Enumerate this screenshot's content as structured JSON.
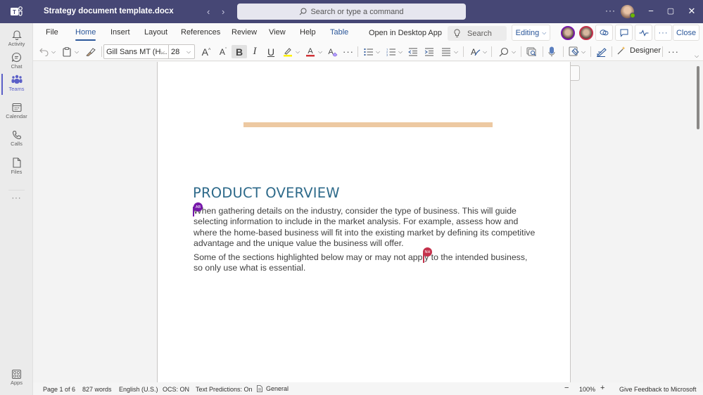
{
  "titlebar": {
    "app_icon": "teams-logo-icon",
    "title": "Strategy document template.docx",
    "back": "‹",
    "forward": "›",
    "search_placeholder": "Search or type a command",
    "more": "···",
    "minimize": "−",
    "maximize": "▢",
    "close": "✕"
  },
  "rail": {
    "items": [
      {
        "label": "Activity",
        "icon": "bell-icon"
      },
      {
        "label": "Chat",
        "icon": "chat-icon"
      },
      {
        "label": "Teams",
        "icon": "teams-icon",
        "active": true
      },
      {
        "label": "Calendar",
        "icon": "calendar-icon"
      },
      {
        "label": "Calls",
        "icon": "phone-icon"
      },
      {
        "label": "Files",
        "icon": "file-icon"
      }
    ],
    "more": "···",
    "apps_label": "Apps"
  },
  "ribbon": {
    "tabs": [
      "File",
      "Home",
      "Insert",
      "Layout",
      "References",
      "Review",
      "View",
      "Help",
      "Table"
    ],
    "active_tab": "Home",
    "open_desktop": "Open in Desktop App",
    "search_placeholder": "Search",
    "editing_label": "Editing",
    "close_label": "Close",
    "coauthor_colors": [
      "#7719aa",
      "#c4314b"
    ]
  },
  "toolbar": {
    "font_name": "Gill Sans MT (H...",
    "font_size": "28",
    "bold": "B",
    "italic": "I",
    "underline": "U",
    "more": "···",
    "designer_label": "Designer",
    "highlight_color": "#fff100",
    "font_color": "#d13438"
  },
  "document": {
    "heading": "PRODUCT OVERVIEW",
    "paragraphs": [
      "When gathering details on the industry, consider the type of business. This will guide selecting information to include in the market analysis. For example, assess how and where the home-based business will fit into the existing market by defining its competitive advantage and the unique value the business will offer.",
      "Some of the sections highlighted below may or may not apply to the intended business, so only use what is essential."
    ],
    "presence": [
      {
        "initials": "AB",
        "color": "#7719aa"
      },
      {
        "initials": "NH",
        "color": "#c4314b"
      }
    ],
    "accent_bar_color": "#edc9a2",
    "heading_color": "#2e6a8a"
  },
  "statusbar": {
    "page": "Page 1 of 6",
    "words": "827 words",
    "language": "English (U.S.)",
    "ocs": "OCS: ON",
    "predictions": "Text Predictions: On",
    "sensitivity": "General",
    "zoom_out": "−",
    "zoom": "100%",
    "zoom_in": "+",
    "feedback": "Give Feedback to Microsoft"
  }
}
